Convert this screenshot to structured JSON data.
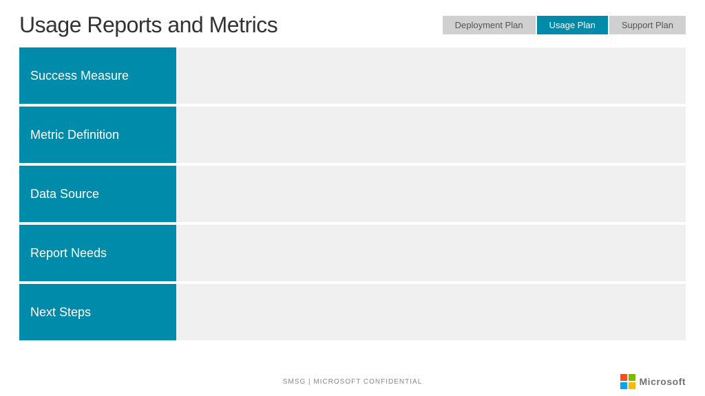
{
  "header": {
    "title": "Usage Reports and Metrics",
    "tabs": [
      {
        "id": "deployment",
        "label": "Deployment Plan",
        "active": false
      },
      {
        "id": "usage",
        "label": "Usage Plan",
        "active": true
      },
      {
        "id": "support",
        "label": "Support Plan",
        "active": false
      }
    ]
  },
  "rows": [
    {
      "id": "success-measure",
      "label": "Success Measure"
    },
    {
      "id": "metric-definition",
      "label": "Metric Definition"
    },
    {
      "id": "data-source",
      "label": "Data Source"
    },
    {
      "id": "report-needs",
      "label": "Report Needs"
    },
    {
      "id": "next-steps",
      "label": "Next Steps"
    }
  ],
  "footer": {
    "confidential": "SMSG | MICROSOFT CONFIDENTIAL"
  },
  "colors": {
    "accent": "#008baa",
    "tab_active_bg": "#008baa",
    "tab_inactive_bg": "#d0d0d0",
    "row_content_bg": "#f0f0f0"
  }
}
